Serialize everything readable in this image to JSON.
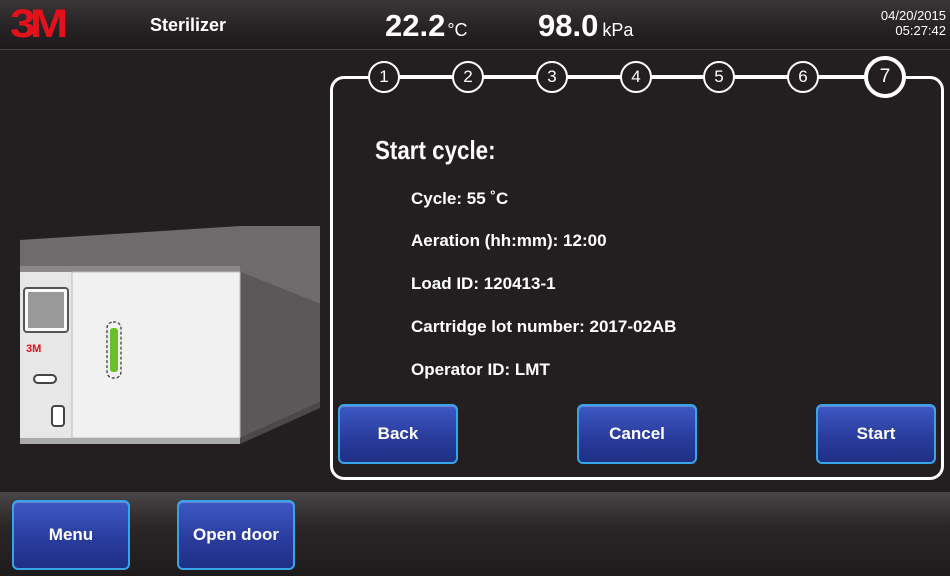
{
  "header": {
    "logo": "3M",
    "device_name": "Sterilizer",
    "temperature": "22.2",
    "temperature_unit": "°C",
    "pressure": "98.0",
    "pressure_unit": "kPa",
    "date": "04/20/2015",
    "time": "05:27:42"
  },
  "steps": [
    "1",
    "2",
    "3",
    "4",
    "5",
    "6",
    "7"
  ],
  "active_step": "7",
  "panel": {
    "title": "Start cycle:",
    "info": [
      "Cycle: 55 ˚C",
      "Aeration (hh:mm): 12:00",
      "Load ID: 120413-1",
      "Cartridge lot number: 2017-02AB",
      "Operator ID: LMT"
    ],
    "buttons": {
      "back": "Back",
      "cancel": "Cancel",
      "start": "Start"
    }
  },
  "footer": {
    "menu": "Menu",
    "open_door": "Open door"
  },
  "machine": {
    "label": "3M"
  },
  "colors": {
    "brand_red": "#e4101b",
    "button_blue": "#2a3d9e",
    "button_border": "#37a4e8",
    "indicator_green": "#6bbf2a"
  }
}
